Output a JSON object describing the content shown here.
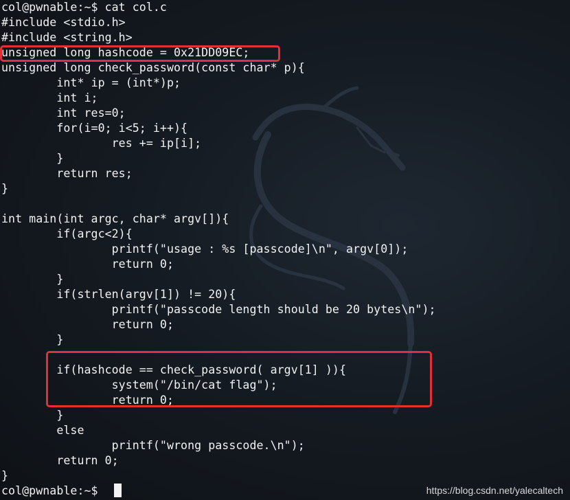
{
  "terminal": {
    "lines": [
      "col@pwnable:~$ cat col.c",
      "#include <stdio.h>",
      "#include <string.h>",
      "unsigned long hashcode = 0x21DD09EC;",
      "unsigned long check_password(const char* p){",
      "        int* ip = (int*)p;",
      "        int i;",
      "        int res=0;",
      "        for(i=0; i<5; i++){",
      "                res += ip[i];",
      "        }",
      "        return res;",
      "}",
      "",
      "int main(int argc, char* argv[]){",
      "        if(argc<2){",
      "                printf(\"usage : %s [passcode]\\n\", argv[0]);",
      "                return 0;",
      "        }",
      "        if(strlen(argv[1]) != 20){",
      "                printf(\"passcode length should be 20 bytes\\n\");",
      "                return 0;",
      "        }",
      "",
      "        if(hashcode == check_password( argv[1] )){",
      "                system(\"/bin/cat flag\");",
      "                return 0;",
      "        }",
      "        else",
      "                printf(\"wrong passcode.\\n\");",
      "        return 0;",
      "}",
      "col@pwnable:~$ "
    ]
  },
  "watermark": "https://blog.csdn.net/yalecaltech",
  "colors": {
    "background": "#151b22",
    "text": "#f2f2f2",
    "highlight": "#e0303a"
  }
}
